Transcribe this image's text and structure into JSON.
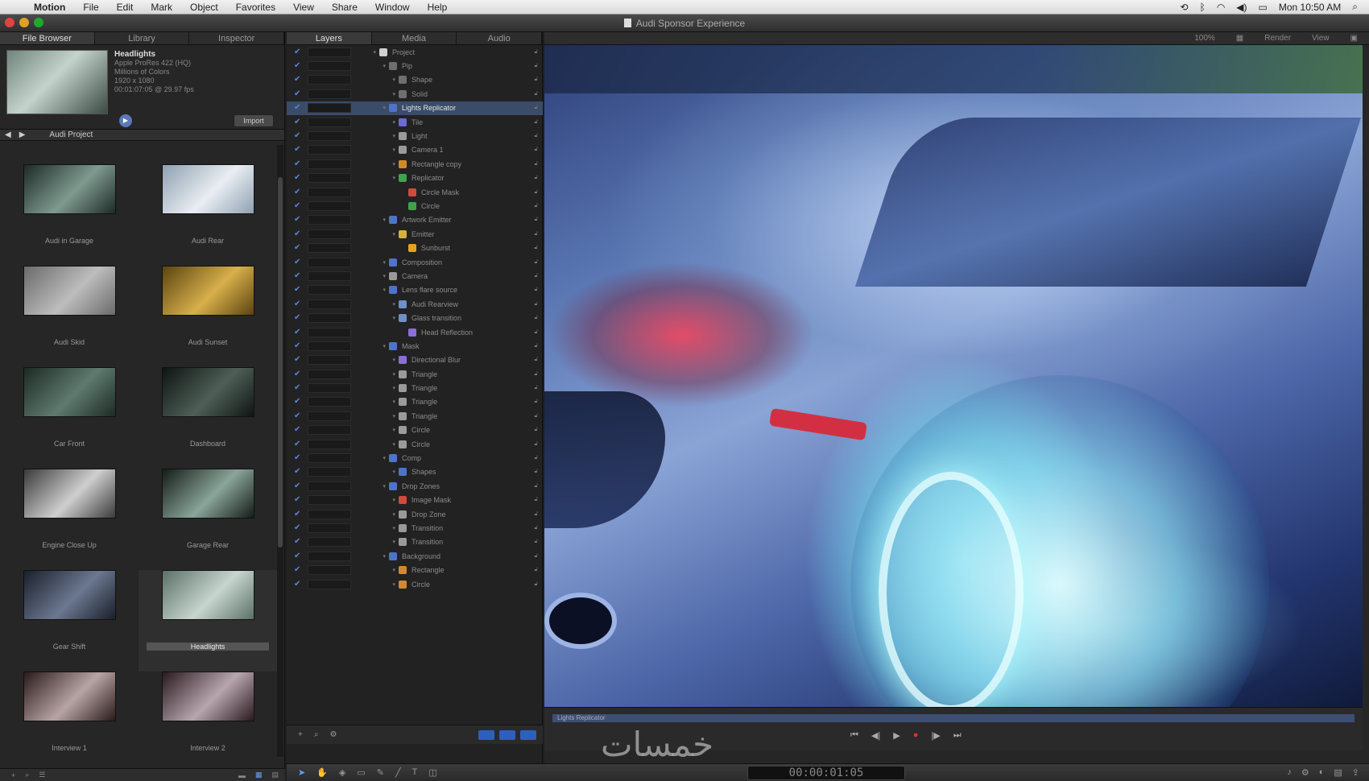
{
  "menubar": {
    "apple": "",
    "items": [
      "Motion",
      "File",
      "Edit",
      "Mark",
      "Object",
      "Favorites",
      "View",
      "Share",
      "Window",
      "Help"
    ],
    "clock": "Mon 10:50 AM"
  },
  "window": {
    "title": "Audi Sponsor Experience",
    "traffic_colors": [
      "#e0443e",
      "#dea123",
      "#1aab29"
    ]
  },
  "left_panel": {
    "tabs": [
      "File Browser",
      "Library",
      "Inspector"
    ],
    "preview": {
      "name": "Headlights",
      "lines": [
        "Apple ProRes 422 (HQ)",
        "Millions of Colors",
        "1920 x 1080",
        "00:01:07:05 @ 29.97 fps"
      ],
      "import_label": "Import"
    },
    "path": "Audi Project",
    "clips": [
      {
        "name": "Audi in Garage",
        "c1": "#1d2a26",
        "c2": "#7f9a90"
      },
      {
        "name": "Audi Rear",
        "c1": "#8fa0b2",
        "c2": "#e9eef2"
      },
      {
        "name": "Audi Skid",
        "c1": "#6a6a6a",
        "c2": "#bdbdbd"
      },
      {
        "name": "Audi Sunset",
        "c1": "#5a4310",
        "c2": "#d7b04b"
      },
      {
        "name": "Car Front",
        "c1": "#1c2a24",
        "c2": "#5f7a70"
      },
      {
        "name": "Dashboard",
        "c1": "#0f1412",
        "c2": "#4e5f58"
      },
      {
        "name": "Engine Close Up",
        "c1": "#3a3a3a",
        "c2": "#cfcfcf"
      },
      {
        "name": "Garage Rear",
        "c1": "#141c18",
        "c2": "#8aa59a"
      },
      {
        "name": "Gear Shift",
        "c1": "#1a1f2a",
        "c2": "#6b7890"
      },
      {
        "name": "Headlights",
        "c1": "#5b7068",
        "c2": "#c7d6cf",
        "selected": true
      },
      {
        "name": "Interview 1",
        "c1": "#2a1a1a",
        "c2": "#b8a4a4"
      },
      {
        "name": "Interview 2",
        "c1": "#2a1a1f",
        "c2": "#b7a6ae"
      }
    ]
  },
  "layers_panel": {
    "tabs": [
      "Layers",
      "Media",
      "Audio"
    ],
    "rows": [
      {
        "label": "Project",
        "indent": 0,
        "color": "#cfcfcf"
      },
      {
        "label": "Pip",
        "indent": 1,
        "color": "#6f6f6f"
      },
      {
        "label": "Shape",
        "indent": 2,
        "color": "#6f6f6f"
      },
      {
        "label": "Solid",
        "indent": 2,
        "color": "#6f6f6f"
      },
      {
        "label": "Lights Replicator",
        "indent": 1,
        "color": "#4f74c7",
        "selected": true
      },
      {
        "label": "Tile",
        "indent": 2,
        "color": "#6b6bd6"
      },
      {
        "label": "Light",
        "indent": 2,
        "color": "#9a9a9a"
      },
      {
        "label": "Camera 1",
        "indent": 2,
        "color": "#9a9a9a"
      },
      {
        "label": "Rectangle copy",
        "indent": 2,
        "color": "#d08a2c"
      },
      {
        "label": "Replicator",
        "indent": 2,
        "color": "#3fa34d"
      },
      {
        "label": "Circle Mask",
        "indent": 3,
        "color": "#d34a3c"
      },
      {
        "label": "Circle",
        "indent": 3,
        "color": "#3fa34d"
      },
      {
        "label": "Artwork Emitter",
        "indent": 1,
        "color": "#4f74c7"
      },
      {
        "label": "Emitter",
        "indent": 2,
        "color": "#d6b13a"
      },
      {
        "label": "Sunburst",
        "indent": 3,
        "color": "#e6a21f"
      },
      {
        "label": "Composition",
        "indent": 1,
        "color": "#4f74c7"
      },
      {
        "label": "Camera",
        "indent": 1,
        "color": "#9a9a9a"
      },
      {
        "label": "Lens flare source",
        "indent": 1,
        "color": "#4f74c7"
      },
      {
        "label": "Audi Rearview",
        "indent": 2,
        "color": "#6f8fc7"
      },
      {
        "label": "Glass transition",
        "indent": 2,
        "color": "#6f8fc7"
      },
      {
        "label": "Head Reflection",
        "indent": 3,
        "color": "#8a6fd6"
      },
      {
        "label": "Mask",
        "indent": 1,
        "color": "#4f74c7"
      },
      {
        "label": "Directional Blur",
        "indent": 2,
        "color": "#8a6fd6"
      },
      {
        "label": "Triangle",
        "indent": 2,
        "color": "#9a9a9a"
      },
      {
        "label": "Triangle",
        "indent": 2,
        "color": "#9a9a9a"
      },
      {
        "label": "Triangle",
        "indent": 2,
        "color": "#9a9a9a"
      },
      {
        "label": "Triangle",
        "indent": 2,
        "color": "#9a9a9a"
      },
      {
        "label": "Circle",
        "indent": 2,
        "color": "#9a9a9a"
      },
      {
        "label": "Circle",
        "indent": 2,
        "color": "#9a9a9a"
      },
      {
        "label": "Comp",
        "indent": 1,
        "color": "#4f74c7"
      },
      {
        "label": "Shapes",
        "indent": 2,
        "color": "#4f74c7"
      },
      {
        "label": "Drop Zones",
        "indent": 1,
        "color": "#4f74c7"
      },
      {
        "label": "Image Mask",
        "indent": 2,
        "color": "#d34a3c"
      },
      {
        "label": "Drop Zone",
        "indent": 2,
        "color": "#9a9a9a"
      },
      {
        "label": "Transition",
        "indent": 2,
        "color": "#9a9a9a"
      },
      {
        "label": "Transition",
        "indent": 2,
        "color": "#9a9a9a"
      },
      {
        "label": "Background",
        "indent": 1,
        "color": "#4f74c7"
      },
      {
        "label": "Rectangle",
        "indent": 2,
        "color": "#d08a2c"
      },
      {
        "label": "Circle",
        "indent": 2,
        "color": "#d08a2c"
      }
    ]
  },
  "canvas": {
    "toolbar": [
      "100%",
      "Render",
      "View"
    ],
    "clip_label": "Lights Replicator",
    "timecode": "00:00:01:05"
  },
  "watermark": "خمسات"
}
